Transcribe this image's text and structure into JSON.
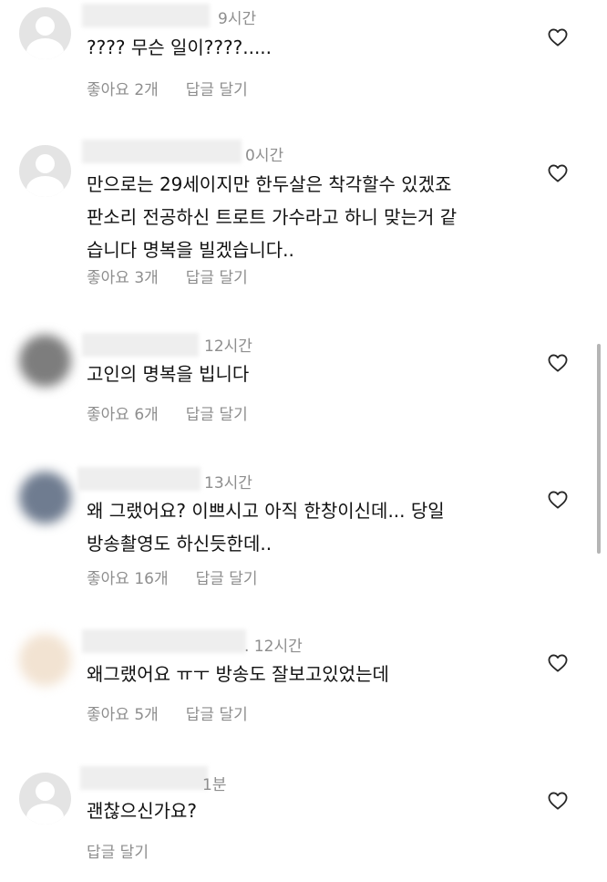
{
  "comments": [
    {
      "time": "9시간",
      "text": [
        "???? 무슨 일이????....."
      ],
      "likes": "좋아요 2개",
      "reply": "답글 달기",
      "avatar": "default-avatar",
      "avatar_color": "#e4e4e4"
    },
    {
      "time": "0시간",
      "text": [
        "만으로는 29세이지만 한두살은 착각할수 있겠죠",
        "판소리 전공하신 트로트 가수라고 하니 맞는거 같",
        "습니다 명복을 빌겠습니다.."
      ],
      "likes": "좋아요 3개",
      "reply": "답글 달기",
      "avatar": "default-avatar",
      "avatar_color": "#e4e4e4"
    },
    {
      "time": "12시간",
      "text": [
        "고인의 명복을 빕니다"
      ],
      "likes": "좋아요 6개",
      "reply": "답글 달기",
      "avatar": "blurred-avatar",
      "avatar_color": "#7d7d7d"
    },
    {
      "time": "13시간",
      "text": [
        "왜 그랬어요? 이쁘시고 아직 한창이신데... 당일",
        "방송촬영도 하신듯한데.."
      ],
      "likes": "좋아요 16개",
      "reply": "답글 달기",
      "avatar": "blurred-avatar",
      "avatar_color": "#6f7c90"
    },
    {
      "time": ". 12시간",
      "text": [
        "왜그랬어요 ㅠㅜ 방송도 잘보고있었는데"
      ],
      "likes": "좋아요 5개",
      "reply": "답글 달기",
      "avatar": "blurred-avatar",
      "avatar_color": "#f2e3d2"
    },
    {
      "time": "1분",
      "text": [
        "괜찮으신가요?"
      ],
      "likes": "",
      "reply": "답글 달기",
      "avatar": "default-avatar",
      "avatar_color": "#e4e4e4"
    }
  ],
  "icons": {
    "like": "heart-outline-icon"
  },
  "colors": {
    "text": "#111111",
    "meta": "#8e8e8e",
    "background": "#ffffff"
  }
}
